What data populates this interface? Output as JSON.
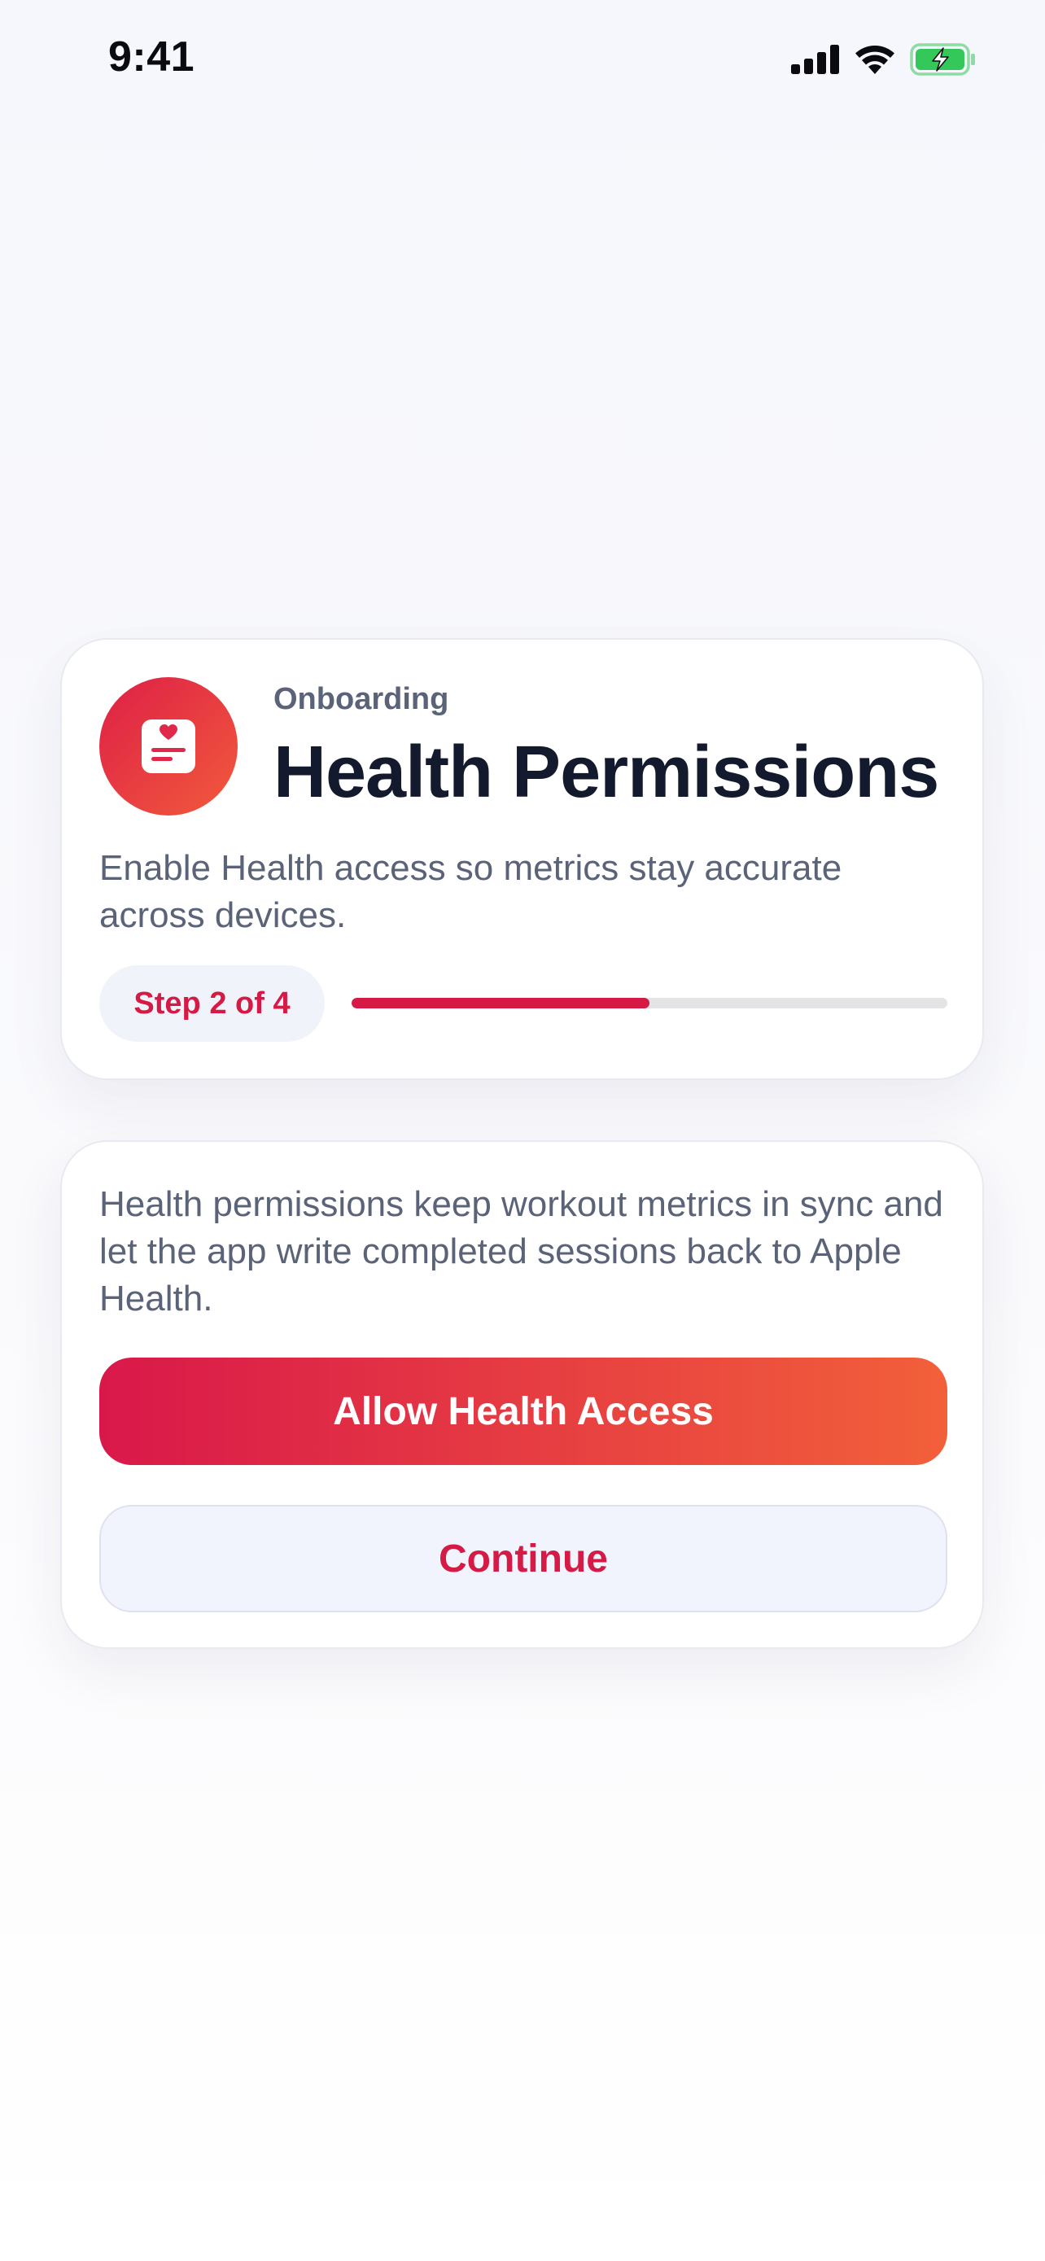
{
  "status_bar": {
    "time": "9:41",
    "icons": [
      "cellular-signal-icon",
      "wifi-icon",
      "battery-charging-icon"
    ],
    "battery_color": "#34c759"
  },
  "header": {
    "icon": "health-record-icon",
    "eyebrow": "Onboarding",
    "title": "Health Permissions",
    "subtitle": "Enable Health access so metrics stay accurate across devices.",
    "step_label": "Step 2 of 4",
    "progress": 0.5
  },
  "actions": {
    "description": "Health permissions keep workout metrics in sync and let the app write completed sessions back to Apple Health.",
    "primary_label": "Allow Health Access",
    "secondary_label": "Continue"
  },
  "colors": {
    "accent": "#d41a45",
    "gradient_start": "#d9184a",
    "gradient_end": "#f2603a",
    "text_primary": "#141a2e",
    "text_secondary": "#5b6378",
    "track": "#e4e4e6"
  }
}
